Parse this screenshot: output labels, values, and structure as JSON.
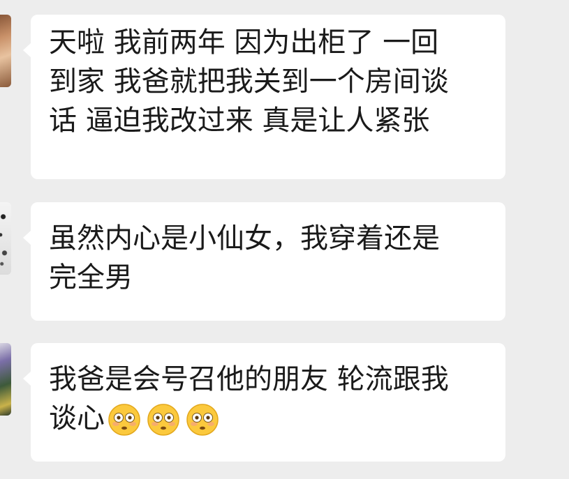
{
  "messages": [
    {
      "lines": [
        "天啦 我前两年 因为出柜了 一回",
        "到家 我爸就把我关到一个房间谈",
        "话 逼迫我改过来 真是让人紧张"
      ]
    },
    {
      "lines": [
        "虽然内心是小仙女，我穿着还是",
        "完全男"
      ]
    },
    {
      "lines": [
        "我爸是会号召他的朋友 轮流跟我",
        "谈心"
      ],
      "emojis": [
        "flushed-face-icon",
        "flushed-face-icon",
        "flushed-face-icon"
      ]
    }
  ],
  "colors": {
    "background": "#ededed",
    "bubble": "#ffffff",
    "text": "#1a1a1a",
    "emoji_face": "#fbc93d"
  }
}
